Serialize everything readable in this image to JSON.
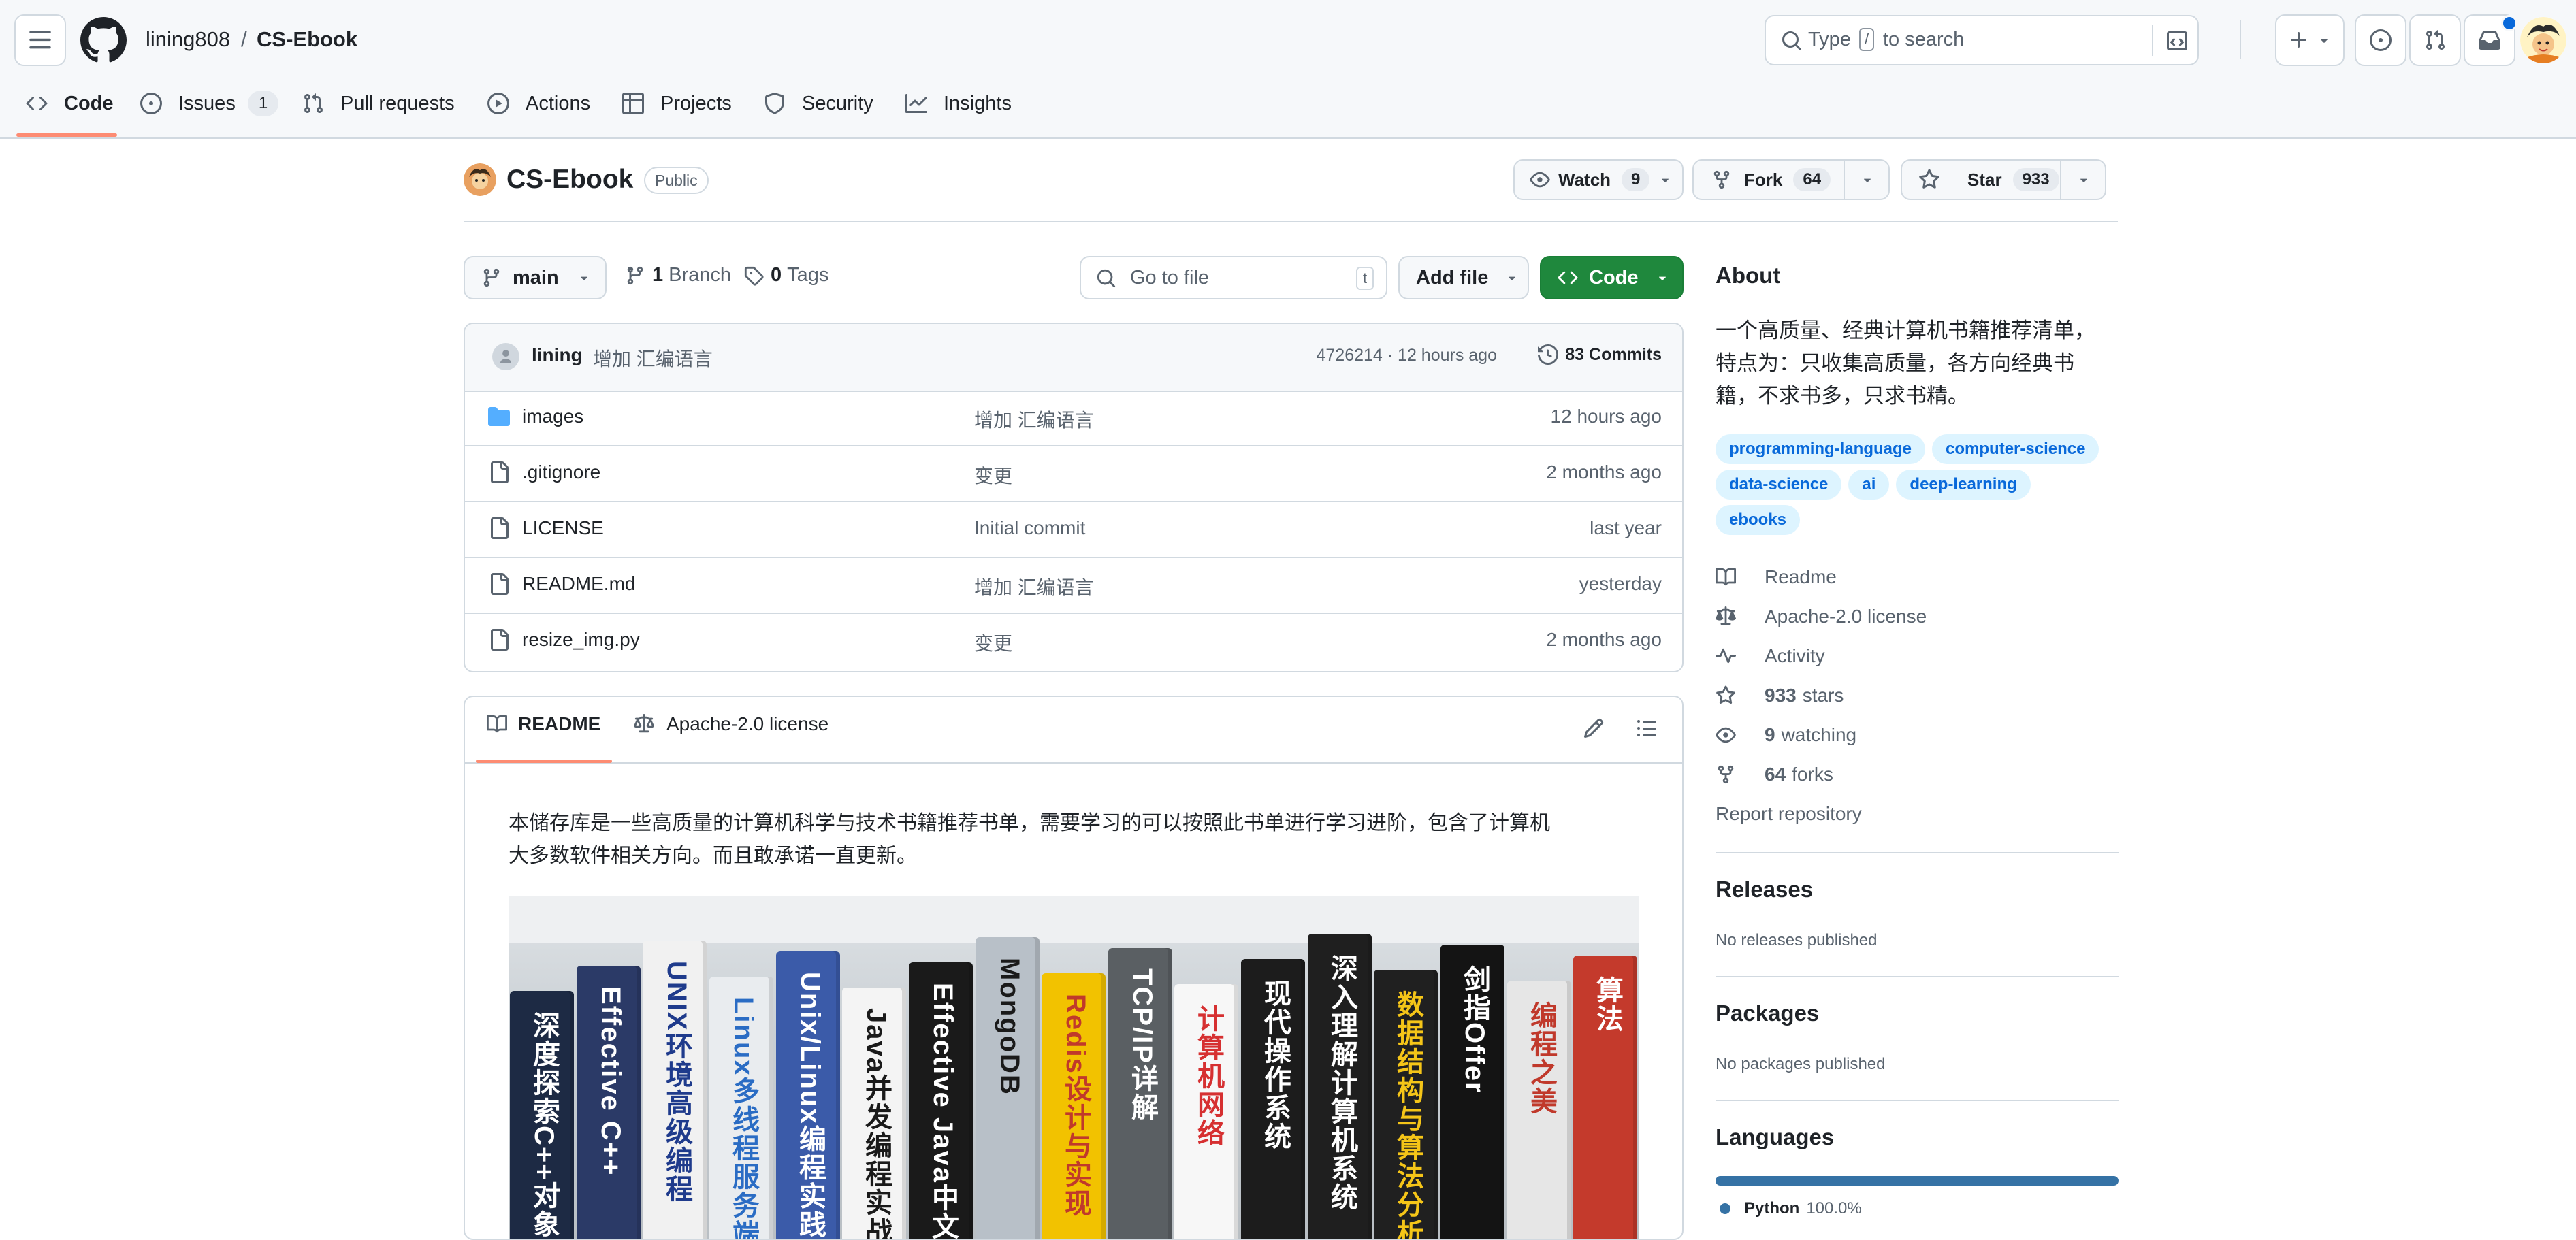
{
  "header": {
    "owner": "lining808",
    "separator": "/",
    "repo": "CS-Ebook",
    "search_placeholder_pre": "Type",
    "search_key": "/",
    "search_placeholder_post": "to search"
  },
  "tabs": [
    {
      "label": "Code",
      "icon": "code-icon",
      "active": true
    },
    {
      "label": "Issues",
      "icon": "issue-icon",
      "count": "1"
    },
    {
      "label": "Pull requests",
      "icon": "pull-request-icon"
    },
    {
      "label": "Actions",
      "icon": "play-icon"
    },
    {
      "label": "Projects",
      "icon": "table-icon"
    },
    {
      "label": "Security",
      "icon": "shield-icon"
    },
    {
      "label": "Insights",
      "icon": "graph-icon"
    }
  ],
  "repo_header": {
    "name": "CS-Ebook",
    "visibility": "Public",
    "watch_label": "Watch",
    "watch_count": "9",
    "fork_label": "Fork",
    "fork_count": "64",
    "star_label": "Star",
    "star_count": "933"
  },
  "toolbar": {
    "branch": "main",
    "branch_count": "1",
    "branch_label": "Branch",
    "tag_count": "0",
    "tag_label": "Tags",
    "go_to_file": "Go to file",
    "go_to_file_key": "t",
    "add_file": "Add file",
    "code": "Code"
  },
  "latest_commit": {
    "author": "lining",
    "message": "增加 汇编语言",
    "hash_time": "4726214 · 12 hours ago",
    "commits_label": "83 Commits"
  },
  "files": [
    {
      "name": "images",
      "type": "dir",
      "message": "增加 汇编语言",
      "time": "12 hours ago"
    },
    {
      "name": ".gitignore",
      "type": "file",
      "message": "变更",
      "time": "2 months ago"
    },
    {
      "name": "LICENSE",
      "type": "file",
      "message": "Initial commit",
      "time": "last year"
    },
    {
      "name": "README.md",
      "type": "file",
      "message": "增加 汇编语言",
      "time": "yesterday"
    },
    {
      "name": "resize_img.py",
      "type": "file",
      "message": "变更",
      "time": "2 months ago"
    }
  ],
  "readme": {
    "tab_readme": "README",
    "tab_license": "Apache-2.0 license",
    "intro_line1": "本储存库是一些高质量的计算机科学与技术书籍推荐书单，需要学习的可以按照此书单进行学习进阶，包含了计算机",
    "intro_line2": "大多数软件相关方向。而且敢承诺一直更新。",
    "books": [
      "深度探索C++对象模型",
      "Effective C++",
      "UNIX环境高级编程",
      "Linux多线程服务端编程",
      "Unix/Linux编程实践",
      "Java并发编程实战",
      "Effective Java中文版",
      "MongoDB",
      "Redis设计与实现",
      "TCP/IP详解",
      "计算机网络",
      "现代操作系统",
      "深入理解计算机系统",
      "数据结构与算法分析",
      "剑指Offer",
      "编程之美",
      "算法"
    ]
  },
  "about": {
    "title": "About",
    "desc_line1": "一个高质量、经典计算机书籍推荐清单，",
    "desc_line2": "特点为：只收集高质量，各方向经典书",
    "desc_line3": "籍，不求书多，只求书精。",
    "topics": [
      "programming-language",
      "computer-science",
      "data-science",
      "ai",
      "deep-learning",
      "ebooks"
    ],
    "readme": "Readme",
    "license": "Apache-2.0 license",
    "activity": "Activity",
    "stars_count": "933",
    "stars_label": "stars",
    "watching_count": "9",
    "watching_label": "watching",
    "forks_count": "64",
    "forks_label": "forks",
    "report": "Report repository"
  },
  "releases": {
    "title": "Releases",
    "empty": "No releases published"
  },
  "packages": {
    "title": "Packages",
    "empty": "No packages published"
  },
  "languages": {
    "title": "Languages",
    "items": [
      {
        "name": "Python",
        "percent": "100.0%",
        "color": "#3572A5",
        "fraction": 1.0
      }
    ]
  },
  "colors": {
    "accent": "#0969da",
    "code_button": "#1f883d",
    "active_tab": "#fd8c73"
  }
}
